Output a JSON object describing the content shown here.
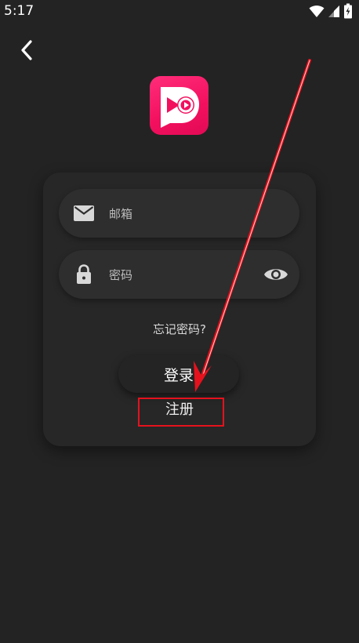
{
  "status_bar": {
    "time": "5:17"
  },
  "icons": {
    "back": "chevron-left-icon",
    "logo": "video-play-logo",
    "email": "mail-icon",
    "password": "lock-icon",
    "visibility": "eye-icon"
  },
  "form": {
    "email_placeholder": "邮箱",
    "password_placeholder": "密码",
    "forgot_password": "忘记密码?",
    "login_label": "登录",
    "register_label": "注册"
  },
  "colors": {
    "background": "#232323",
    "card": "#272727",
    "brand": "#f2105e",
    "annotation": "#e5121d"
  }
}
